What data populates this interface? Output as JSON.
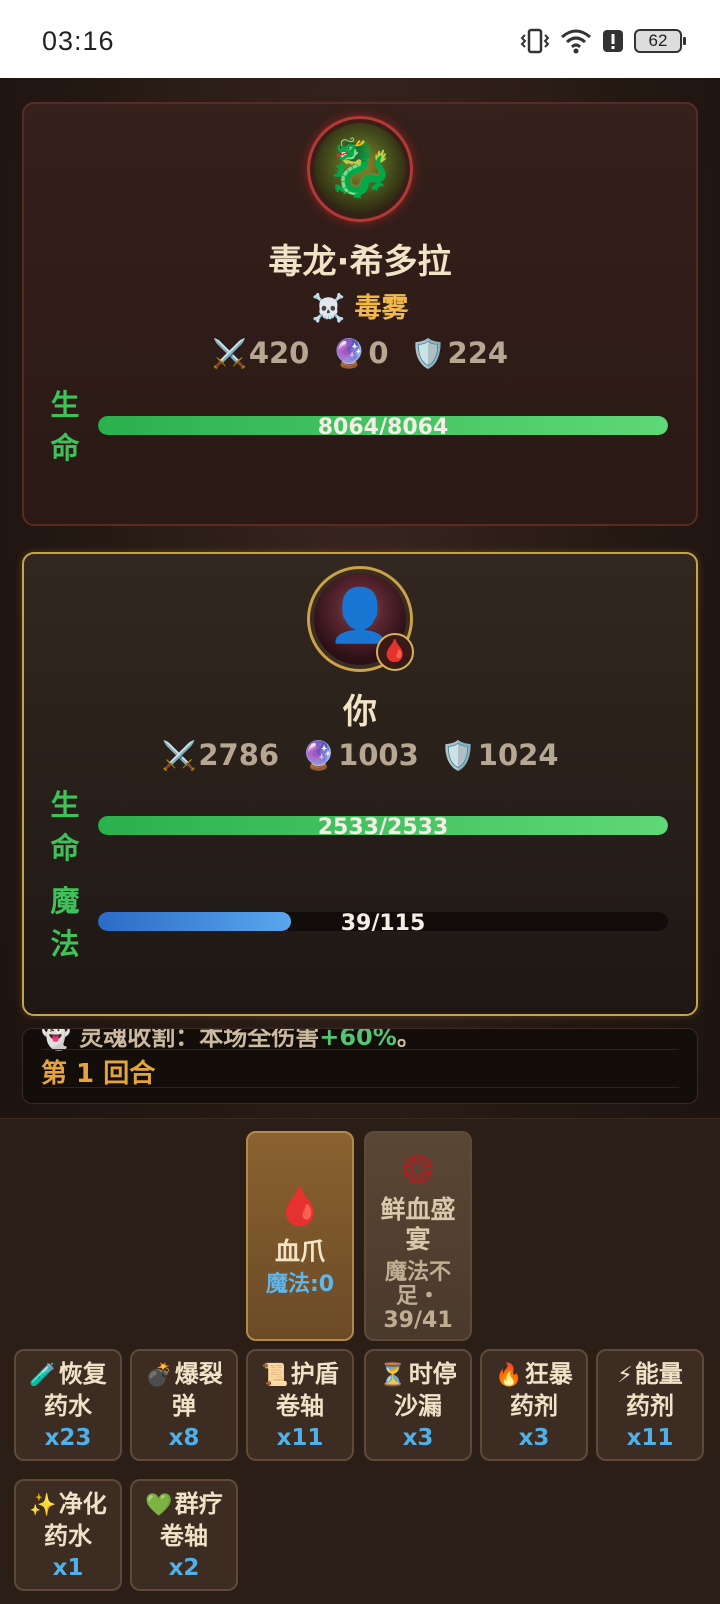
{
  "status_bar": {
    "time": "03:16",
    "battery": "62"
  },
  "enemy": {
    "name": "毒龙·希多拉",
    "status_icon": "skull-icon",
    "status_effect": "毒雾",
    "attack": "420",
    "magic": "0",
    "defense": "224",
    "hp_label": "生\n命",
    "hp_text": "8064/8064",
    "hp_fraction": 1.0
  },
  "player": {
    "name": "你",
    "attack": "2786",
    "magic": "1003",
    "defense": "1024",
    "hp_label": "生\n命",
    "hp_text": "2533/2533",
    "hp_fraction": 1.0,
    "mp_label": "魔\n法",
    "mp_text": "39/115",
    "mp_fraction": 0.339
  },
  "battle_log": {
    "previous_line_start": "灵魂收割：本场全伤害",
    "previous_line_highlight": "+60%",
    "previous_line_end": "。",
    "round": "第 1 回合"
  },
  "skills": [
    {
      "name": "血爪",
      "cost": "魔法:0",
      "icon": "claw-icon",
      "enabled": true
    },
    {
      "name": "鲜血盛宴",
      "cost": "魔法不足・39/41",
      "icon": "blood-feast-icon",
      "enabled": false
    }
  ],
  "items": [
    {
      "name": "恢复药水",
      "icon": "🧪",
      "count": "x23"
    },
    {
      "name": "爆裂弹",
      "icon": "💣",
      "count": "x8"
    },
    {
      "name": "护盾卷轴",
      "icon": "📜",
      "count": "x11"
    },
    {
      "name": "时停沙漏",
      "icon": "⏳",
      "count": "x3"
    },
    {
      "name": "狂暴药剂",
      "icon": "🔥",
      "count": "x3"
    },
    {
      "name": "能量药剂",
      "icon": "⚡",
      "count": "x11"
    },
    {
      "name": "净化药水",
      "icon": "✨",
      "count": "x1"
    },
    {
      "name": "群疗卷轴",
      "icon": "💚",
      "count": "x2"
    }
  ],
  "colors": {
    "hp_green": "#3fc25a",
    "mp_blue": "#3f8ee0",
    "gold_border": "#c9a24a",
    "enemy_border": "#5a2b23"
  }
}
